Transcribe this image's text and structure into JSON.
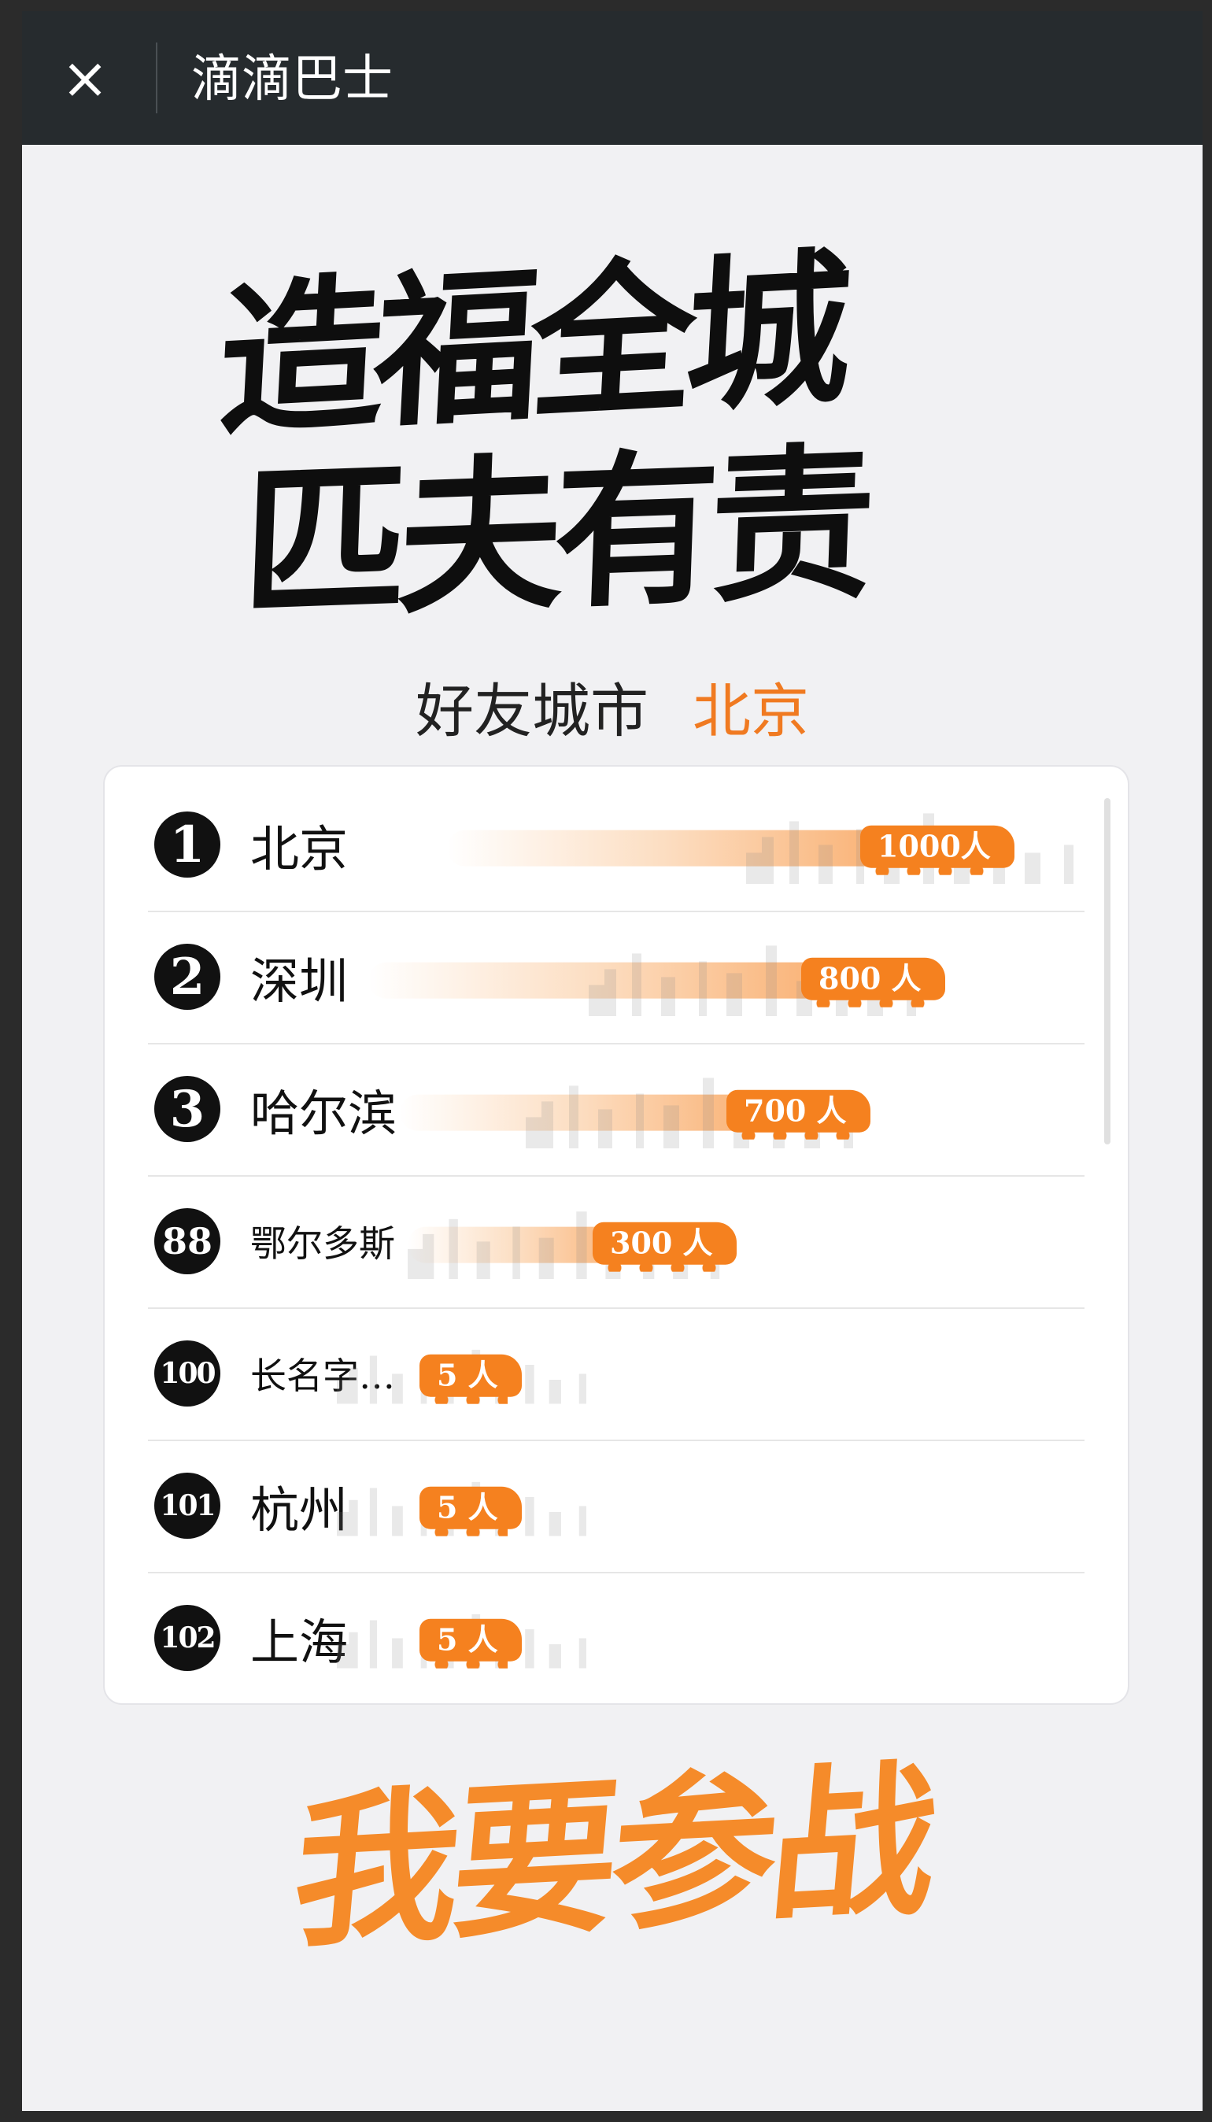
{
  "navbar": {
    "close_icon": "×",
    "title": "滴滴巴士"
  },
  "hero": {
    "line1": "造福全城",
    "line2": "匹夫有责"
  },
  "city": {
    "label": "好友城市",
    "value": "北京"
  },
  "ranking": {
    "rows": [
      {
        "rank": "1",
        "name": "北京",
        "count": "1000人"
      },
      {
        "rank": "2",
        "name": "深圳",
        "count": "800 人"
      },
      {
        "rank": "3",
        "name": "哈尔滨",
        "count": "700 人"
      },
      {
        "rank": "88",
        "name": "鄂尔多斯",
        "count": "300 人"
      },
      {
        "rank": "100",
        "name": "长名字…",
        "count": "5 人"
      },
      {
        "rank": "101",
        "name": "杭州",
        "count": "5 人"
      },
      {
        "rank": "102",
        "name": "上海",
        "count": "5 人"
      }
    ]
  },
  "cta": {
    "label": "我要参战"
  },
  "colors": {
    "accent": "#f5811f",
    "navbar": "#262b2e",
    "background": "#f1f1f3"
  }
}
